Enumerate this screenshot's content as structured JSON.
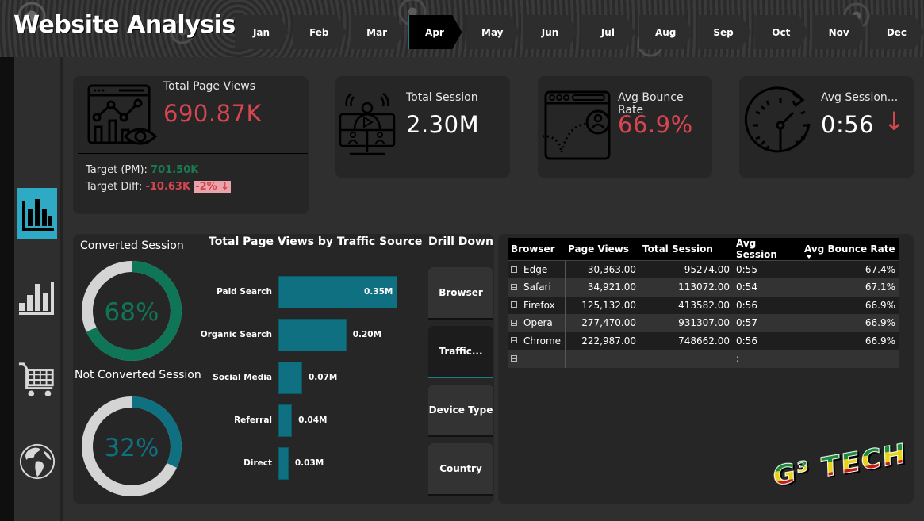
{
  "header": {
    "title": "Website Analysis",
    "months": [
      {
        "label": "Jan",
        "active": false
      },
      {
        "label": "Feb",
        "active": false
      },
      {
        "label": "Mar",
        "active": false
      },
      {
        "label": "Apr",
        "active": true
      },
      {
        "label": "May",
        "active": false
      },
      {
        "label": "Jun",
        "active": false
      },
      {
        "label": "Jul",
        "active": false
      },
      {
        "label": "Aug",
        "active": false
      },
      {
        "label": "Sep",
        "active": false
      },
      {
        "label": "Oct",
        "active": false
      },
      {
        "label": "Nov",
        "active": false
      },
      {
        "label": "Dec",
        "active": false
      }
    ]
  },
  "sidebar": {
    "items": [
      {
        "icon": "bar-chart-icon",
        "active": true
      },
      {
        "icon": "ascending-bar-chart-icon",
        "active": false
      },
      {
        "icon": "shopping-cart-icon",
        "active": false
      },
      {
        "icon": "globe-icon",
        "active": false
      }
    ]
  },
  "kpis": {
    "page_views": {
      "label": "Total Page Views",
      "value": "690.87K",
      "target_label": "Target (PM):",
      "target_value": "701.50K",
      "diff_label": "Target Diff:",
      "diff_value": "-10.63K",
      "diff_pct": "-2%",
      "diff_arrow": "↓"
    },
    "total_session": {
      "label": "Total Session",
      "value": "2.30M"
    },
    "bounce_rate": {
      "label": "Avg Bounce Rate",
      "value": "66.9%"
    },
    "avg_session": {
      "label": "Avg Session...",
      "value": "0:56",
      "trend_arrow": "↓"
    }
  },
  "colors": {
    "accent": "#2eaac4",
    "teal_bar": "#0e7080",
    "negative": "#d64550",
    "positive": "#1a7a50",
    "donut_track": "#d4d4d4"
  },
  "conversion": {
    "converted": {
      "label": "Converted Session",
      "percent": 68,
      "display": "68%",
      "color": "#0e7556"
    },
    "not_converted": {
      "label": "Not Converted Session",
      "percent": 32,
      "display": "32%",
      "color": "#0e7080"
    }
  },
  "chart_data": {
    "type": "bar",
    "orientation": "horizontal",
    "title": "Total Page Views by Traffic Source",
    "categories": [
      "Paid Search",
      "Organic Search",
      "Social Media",
      "Referral",
      "Direct"
    ],
    "values": [
      0.35,
      0.2,
      0.07,
      0.04,
      0.03
    ],
    "value_labels": [
      "0.35M",
      "0.20M",
      "0.07M",
      "0.04M",
      "0.03M"
    ],
    "unit": "M",
    "xlabel": "",
    "ylabel": ""
  },
  "drill_down": {
    "title": "Drill Down",
    "buttons": [
      {
        "label": "Browser",
        "active": false
      },
      {
        "label": "Traffic...",
        "active": true
      },
      {
        "label": "Device Type",
        "active": false
      },
      {
        "label": "Country",
        "active": false
      }
    ]
  },
  "table": {
    "columns": [
      "Browser",
      "Page Views",
      "Total Session",
      "Avg Session",
      "Avg Bounce Rate"
    ],
    "sorted_column": "Avg Bounce Rate",
    "rows": [
      [
        "Edge",
        "30,363.00",
        "95274.00",
        "0:55",
        "67.4%"
      ],
      [
        "Safari",
        "34,921.00",
        "113072.00",
        "0:54",
        "67.1%"
      ],
      [
        "Firefox",
        "125,132.00",
        "413582.00",
        "0:56",
        "66.9%"
      ],
      [
        "Opera",
        "277,470.00",
        "931307.00",
        "0:57",
        "66.9%"
      ],
      [
        "Chrome",
        "222,987.00",
        "748662.00",
        "0:56",
        "66.9%"
      ],
      [
        "",
        "",
        "",
        ":",
        ""
      ]
    ]
  },
  "logo": {
    "text": "G³ TECH"
  }
}
